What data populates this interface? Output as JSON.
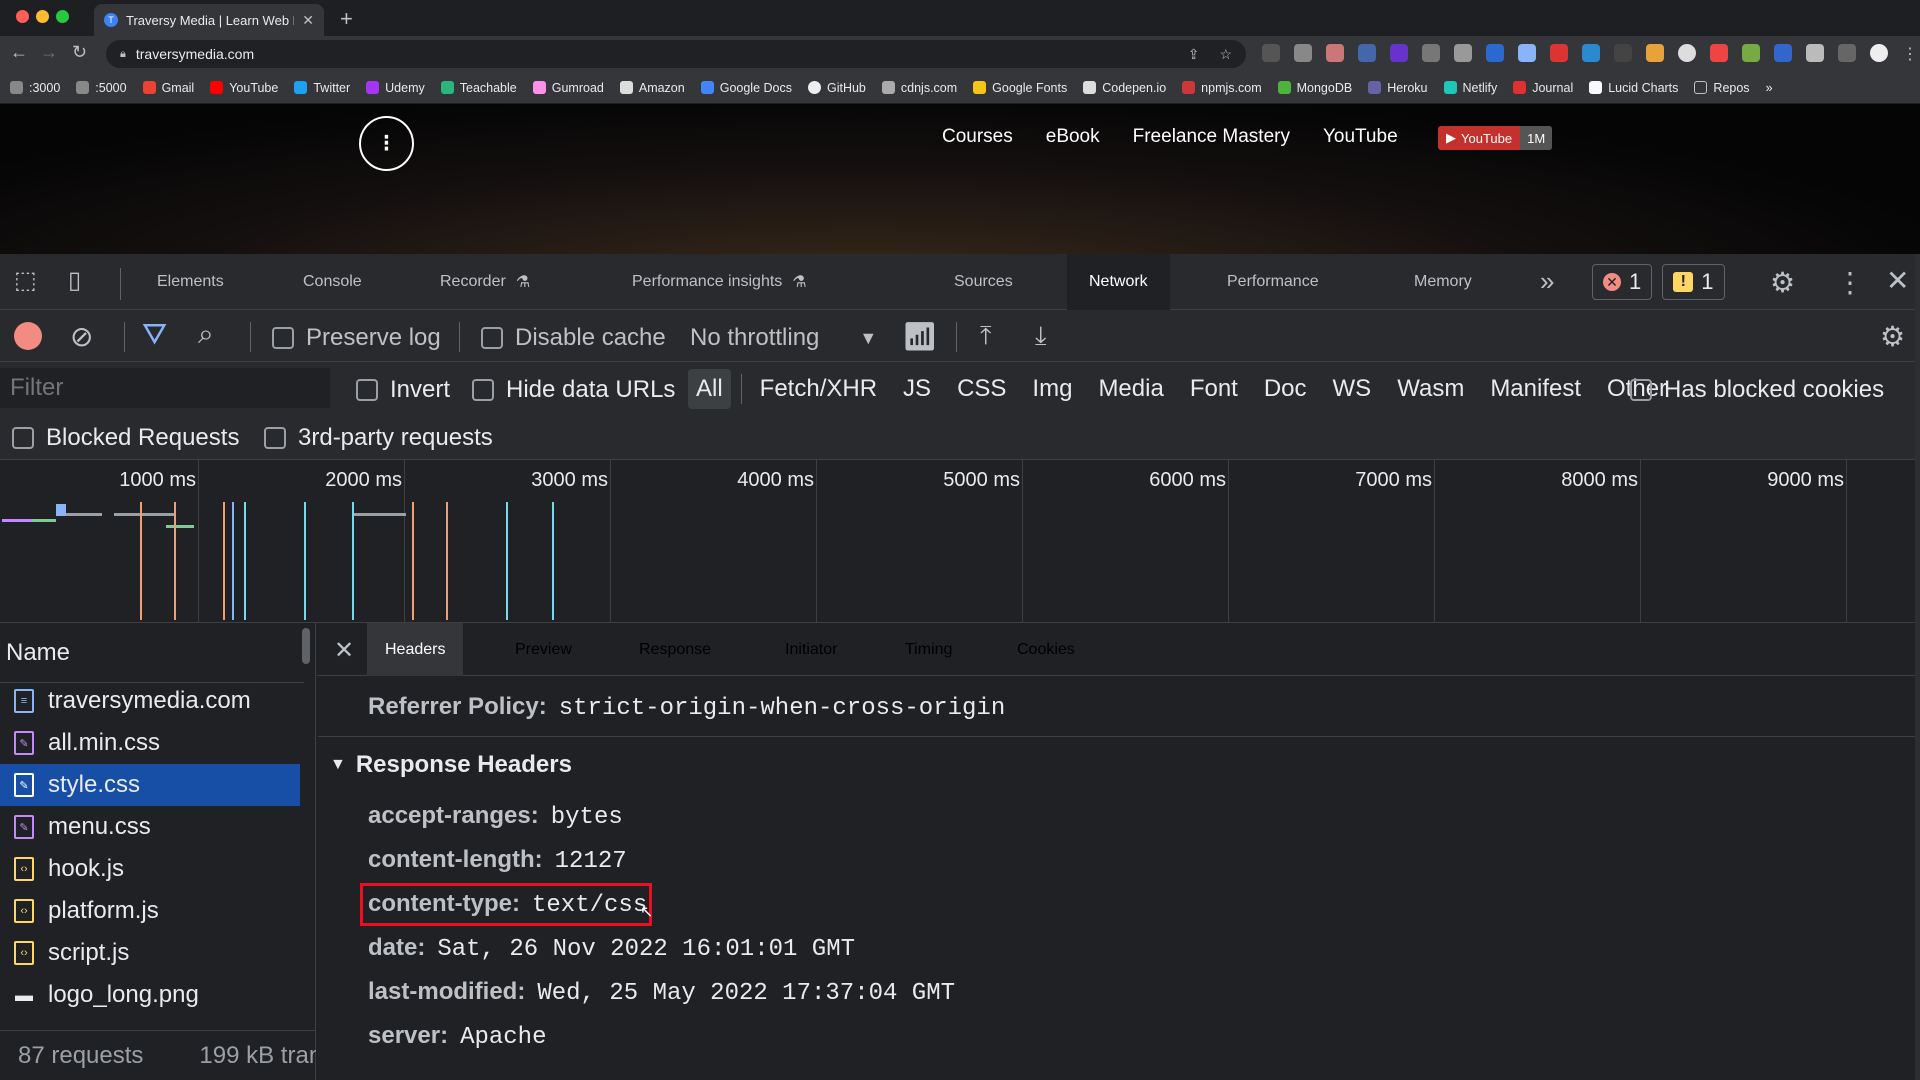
{
  "browser": {
    "tab_title": "Traversy Media | Learn Web De",
    "url": "traversymedia.com",
    "bookmarks": [
      ":3000",
      ":5000",
      "Gmail",
      "YouTube",
      "Twitter",
      "Udemy",
      "Teachable",
      "Gumroad",
      "Amazon",
      "Google Docs",
      "GitHub",
      "cdnjs.com",
      "Google Fonts",
      "Codepen.io",
      "npmjs.com",
      "MongoDB",
      "Heroku",
      "Netlify",
      "Journal",
      "Lucid Charts",
      "Repos"
    ]
  },
  "site": {
    "logo": "⁝",
    "nav": [
      "Courses",
      "eBook",
      "Freelance Mastery",
      "YouTube"
    ],
    "yt_button": "YouTube",
    "yt_count": "1M"
  },
  "devtools": {
    "tabs": [
      "Elements",
      "Console",
      "Recorder",
      "Performance insights",
      "Sources",
      "Network",
      "Performance",
      "Memory"
    ],
    "active_tab": "Network",
    "overflow": "»",
    "error_count": "1",
    "warning_count": "1",
    "network_toolbar": {
      "preserve_log": "Preserve log",
      "disable_cache": "Disable cache",
      "throttling": "No throttling"
    },
    "filter": {
      "placeholder": "Filter",
      "invert": "Invert",
      "hide_data_urls": "Hide data URLs",
      "types": [
        "All",
        "Fetch/XHR",
        "JS",
        "CSS",
        "Img",
        "Media",
        "Font",
        "Doc",
        "WS",
        "Wasm",
        "Manifest",
        "Other"
      ],
      "has_blocked_cookies": "Has blocked cookies",
      "blocked_requests": "Blocked Requests",
      "third_party": "3rd-party requests"
    },
    "timeline_ticks": [
      "1000 ms",
      "2000 ms",
      "3000 ms",
      "4000 ms",
      "5000 ms",
      "6000 ms",
      "7000 ms",
      "8000 ms",
      "9000 ms"
    ],
    "name_header": "Name",
    "files": [
      {
        "name": "traversymedia.com",
        "type": "doc"
      },
      {
        "name": "all.min.css",
        "type": "css"
      },
      {
        "name": "style.css",
        "type": "css"
      },
      {
        "name": "menu.css",
        "type": "css"
      },
      {
        "name": "hook.js",
        "type": "js"
      },
      {
        "name": "platform.js",
        "type": "js"
      },
      {
        "name": "script.js",
        "type": "js"
      },
      {
        "name": "logo_long.png",
        "type": "img"
      }
    ],
    "selected_file": "style.css",
    "summary": {
      "requests": "87 requests",
      "transferred": "199 kB trans"
    },
    "detail_tabs": [
      "Headers",
      "Preview",
      "Response",
      "Initiator",
      "Timing",
      "Cookies"
    ],
    "active_detail_tab": "Headers",
    "referrer_policy": {
      "key": "Referrer Policy:",
      "value": "strict-origin-when-cross-origin"
    },
    "response_headers_title": "Response Headers",
    "response_headers": [
      {
        "key": "accept-ranges:",
        "value": "bytes"
      },
      {
        "key": "content-length:",
        "value": "12127"
      },
      {
        "key": "content-type:",
        "value": "text/css"
      },
      {
        "key": "date:",
        "value": "Sat, 26 Nov 2022 16:01:01 GMT"
      },
      {
        "key": "last-modified:",
        "value": "Wed, 25 May 2022 17:37:04 GMT"
      },
      {
        "key": "server:",
        "value": "Apache"
      }
    ],
    "colors": {
      "accent": "#8ab4f8",
      "selected_row": "#174ea6",
      "record": "#f28b82",
      "highlight_box": "#e81123"
    }
  }
}
